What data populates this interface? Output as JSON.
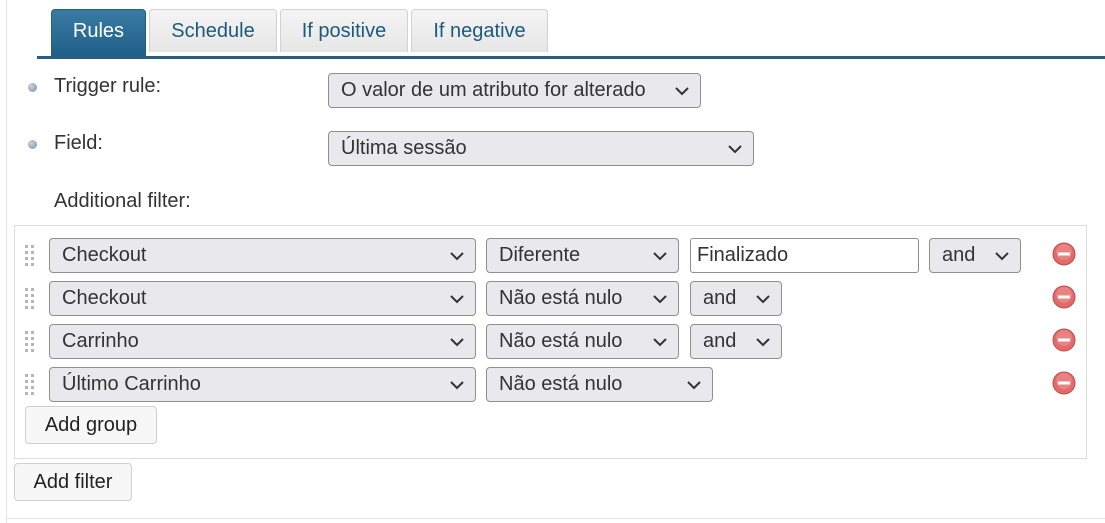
{
  "tabs": [
    {
      "label": "Rules",
      "active": true
    },
    {
      "label": "Schedule",
      "active": false
    },
    {
      "label": "If positive",
      "active": false
    },
    {
      "label": "If negative",
      "active": false
    }
  ],
  "form": {
    "trigger_rule_label": "Trigger rule:",
    "trigger_rule_value": "O valor de um atributo for alterado",
    "field_label": "Field:",
    "field_value": "Última sessão",
    "additional_filter_label": "Additional filter:"
  },
  "filters": [
    {
      "field": "Checkout",
      "operator": "Diferente",
      "value": "Finalizado",
      "connector": "and"
    },
    {
      "field": "Checkout",
      "operator": "Não está nulo",
      "connector": "and"
    },
    {
      "field": "Carrinho",
      "operator": "Não está nulo",
      "connector": "and"
    },
    {
      "field": "Último Carrinho",
      "operator": "Não está nulo"
    }
  ],
  "buttons": {
    "add_group": "Add group",
    "add_filter": "Add filter"
  },
  "colors": {
    "accent": "#245e80",
    "remove_icon": "#d9534f"
  }
}
